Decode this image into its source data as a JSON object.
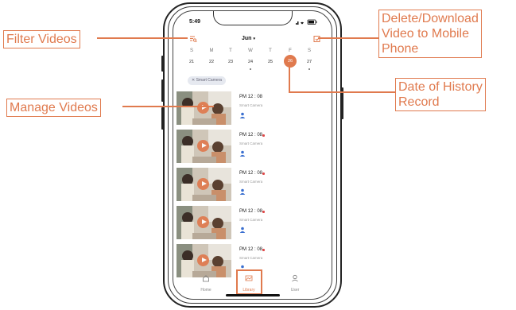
{
  "status_bar": {
    "time": "5:49"
  },
  "header": {
    "month": "Jun",
    "month_caret": "▾"
  },
  "calendar": {
    "weekdays": [
      "S",
      "M",
      "T",
      "W",
      "T",
      "F",
      "S"
    ],
    "days": [
      "21",
      "22",
      "23",
      "24",
      "25",
      "26",
      "27"
    ],
    "selected_day": "26"
  },
  "filter_chip": {
    "label": "✕ Smart Camera"
  },
  "videos": [
    {
      "time": "PM 12 : 08",
      "camera": "Smart Camera"
    },
    {
      "time": "PM 12 : 08",
      "camera": "Smart Camera"
    },
    {
      "time": "PM 12 : 08",
      "camera": "Smart Camera"
    },
    {
      "time": "PM 12 : 08",
      "camera": "Smart Camera"
    },
    {
      "time": "PM 12 : 08",
      "camera": "Smart Camera"
    }
  ],
  "tabbar": {
    "home": "Home",
    "library": "Library",
    "user": "User"
  },
  "callouts": {
    "filter": "Filter Videos",
    "manage": "Manage Videos",
    "delete_line1": "Delete/Download",
    "delete_line2": "Video to Mobile",
    "delete_line3": "Phone",
    "date_line1": "Date of History",
    "date_line2": "Record"
  },
  "colors": {
    "accent": "#e07a4e",
    "record_dot": "#e04848",
    "chip_bg": "#e6e9f0"
  }
}
